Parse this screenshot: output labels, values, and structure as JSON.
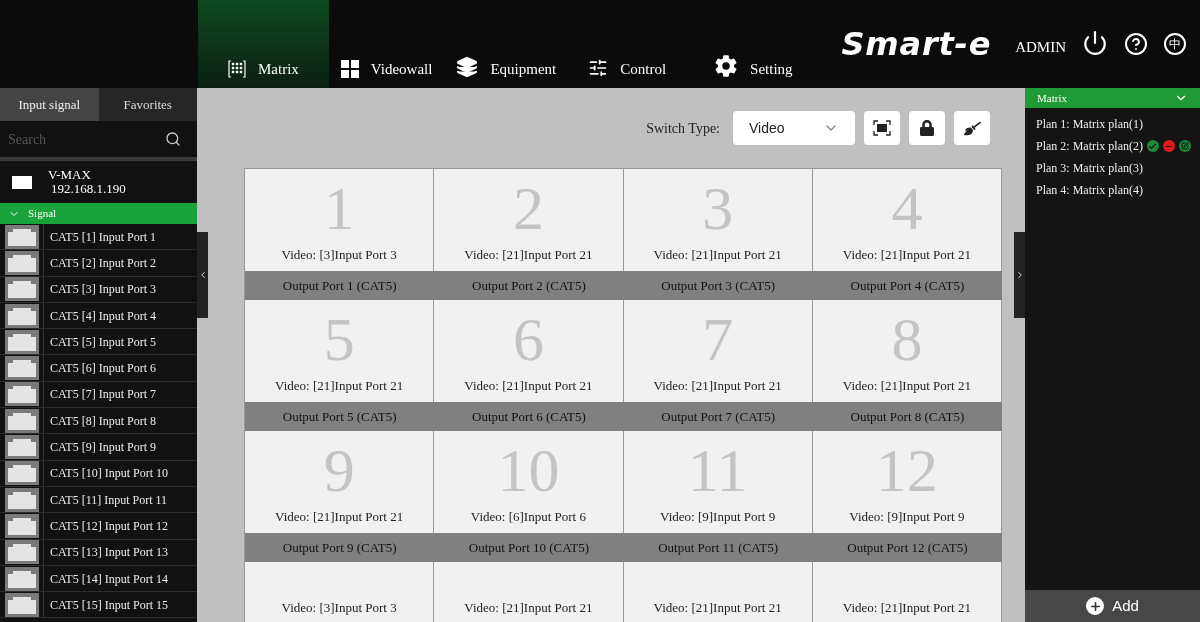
{
  "header": {
    "logo": "Smart-e",
    "user": "ADMIN",
    "language": "中",
    "nav": [
      {
        "kind": "matrix",
        "label": "Matrix",
        "selected": true
      },
      {
        "kind": "videowall",
        "label": "Videowall",
        "selected": false
      },
      {
        "kind": "equipment",
        "label": "Equipment",
        "selected": false
      },
      {
        "kind": "control",
        "label": "Control",
        "selected": false
      },
      {
        "kind": "setting",
        "label": "Setting",
        "selected": false
      }
    ]
  },
  "sidebar": {
    "tabs": [
      {
        "label": "Input signal",
        "selected": true
      },
      {
        "label": "Favorites",
        "selected": false
      }
    ],
    "search": {
      "placeholder": "Search"
    },
    "device": {
      "name": "V-MAX",
      "address": "192.168.1.190"
    },
    "group": {
      "label": "Signal",
      "expanded": true
    },
    "inputs": [
      "CAT5 [1] Input Port 1",
      "CAT5 [2] Input Port 2",
      "CAT5 [3] Input Port 3",
      "CAT5 [4] Input Port 4",
      "CAT5 [5] Input Port 5",
      "CAT5 [6] Input Port 6",
      "CAT5 [7] Input Port 7",
      "CAT5 [8] Input Port 8",
      "CAT5 [9] Input Port 9",
      "CAT5 [10] Input Port 10",
      "CAT5 [11] Input Port 11",
      "CAT5 [12] Input Port 12",
      "CAT5 [13] Input Port 13",
      "CAT5 [14] Input Port 14",
      "CAT5 [15] Input Port 15"
    ]
  },
  "toolbar": {
    "switch_label": "Switch Type:",
    "switch_value": "Video"
  },
  "outputs": [
    {
      "number": "1",
      "input": "Video: [3]Input Port 3",
      "output": "Output Port 1 (CAT5)"
    },
    {
      "number": "2",
      "input": "Video: [21]Input Port 21",
      "output": "Output Port 2 (CAT5)"
    },
    {
      "number": "3",
      "input": "Video: [21]Input Port 21",
      "output": "Output Port 3 (CAT5)"
    },
    {
      "number": "4",
      "input": "Video: [21]Input Port 21",
      "output": "Output Port 4 (CAT5)"
    },
    {
      "number": "5",
      "input": "Video: [21]Input Port 21",
      "output": "Output Port 5 (CAT5)"
    },
    {
      "number": "6",
      "input": "Video: [21]Input Port 21",
      "output": "Output Port 6 (CAT5)"
    },
    {
      "number": "7",
      "input": "Video: [21]Input Port 21",
      "output": "Output Port 7 (CAT5)"
    },
    {
      "number": "8",
      "input": "Video: [21]Input Port 21",
      "output": "Output Port 8 (CAT5)"
    },
    {
      "number": "9",
      "input": "Video: [21]Input Port 21",
      "output": "Output Port 9 (CAT5)"
    },
    {
      "number": "10",
      "input": "Video: [6]Input Port 6",
      "output": "Output Port 10 (CAT5)"
    },
    {
      "number": "11",
      "input": "Video: [9]Input Port 9",
      "output": "Output Port 11 (CAT5)"
    },
    {
      "number": "12",
      "input": "Video: [9]Input Port 9",
      "output": "Output Port 12 (CAT5)"
    },
    {
      "input": "Video: [3]Input Port 3"
    },
    {
      "input": "Video: [21]Input Port 21"
    },
    {
      "input": "Video: [21]Input Port 21"
    },
    {
      "input": "Video: [21]Input Port 21"
    }
  ],
  "plans": {
    "title": "Matrix",
    "expanded": true,
    "items": [
      {
        "label": "Plan 1: Matrix plan(1)",
        "selected": false
      },
      {
        "label": "Plan 2: Matrix plan(2)",
        "selected": true
      },
      {
        "label": "Plan 3: Matrix plan(3)",
        "selected": false
      },
      {
        "label": "Plan 4: Matrix plan(4)",
        "selected": false
      }
    ],
    "add": "Add"
  }
}
